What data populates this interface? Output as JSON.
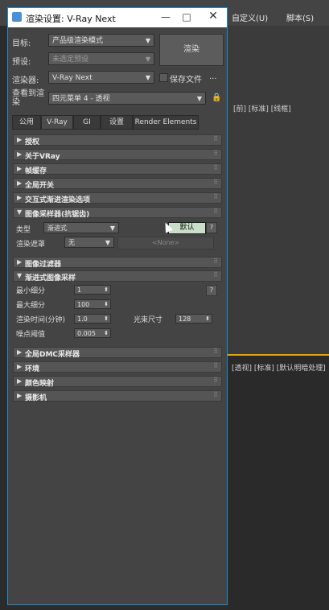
{
  "app_menu": {
    "item1": "自定义(U)",
    "item2": "脚本(S)"
  },
  "viewport_top": {
    "labels": "[前] [标准] [线框]"
  },
  "viewport_bottom": {
    "labels": "[透视] [标准] [默认明暗处理]"
  },
  "dialog": {
    "title": "渲染设置: V-Ray Next",
    "target_label": "目标:",
    "target_value": "产品级渲染模式",
    "preset_label": "预设:",
    "preset_value": "未选定预设",
    "renderer_label": "渲染器:",
    "renderer_value": "V-Ray Next",
    "save_file_label": "保存文件",
    "ellipsis": "...",
    "view_label_1": "查看到渲",
    "view_label_2": "染",
    "view_value": "四元菜单 4 - 透视",
    "render_button": "渲染",
    "tabs": [
      "公用",
      "V-Ray",
      "GI",
      "设置",
      "Render Elements"
    ],
    "rollouts": {
      "r1": "授权",
      "r2": "关于VRay",
      "r3": "帧缓存",
      "r4": "全局开关",
      "r5": "交互式渐进渲染选项",
      "r6": "图像采样器(抗锯齿)",
      "r7": "图像过滤器",
      "r8": "渐进式图像采样",
      "r9": "全局DMC采样器",
      "r10": "环境",
      "r11": "颜色映射",
      "r12": "摄影机"
    },
    "sampler": {
      "type_label": "类型",
      "type_value": "渐进式",
      "default_button": "默认",
      "help": "?",
      "mask_label": "渲染遮罩",
      "mask_value": "无",
      "none_button": "<None>"
    },
    "progressive": {
      "min_label": "最小细分",
      "min_value": "1",
      "max_label": "最大细分",
      "max_value": "100",
      "time_label": "渲染时间(分钟)",
      "time_value": "1.0",
      "bundle_label": "光束尺寸",
      "bundle_value": "128",
      "noise_label": "噪点阈值",
      "noise_value": "0.005",
      "help": "?"
    }
  }
}
